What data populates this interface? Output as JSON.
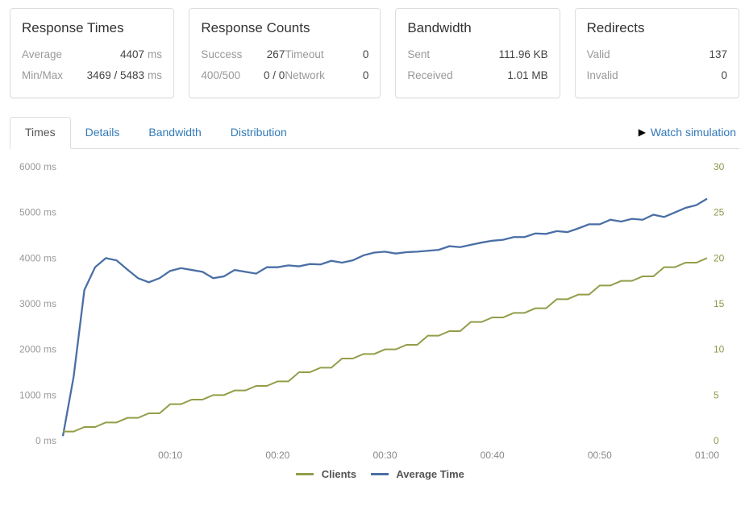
{
  "cards": {
    "response_times": {
      "title": "Response Times",
      "average_label": "Average",
      "average_value": "4407",
      "unit": "ms",
      "minmax_label": "Min/Max",
      "minmax_value": "3469 / 5483"
    },
    "response_counts": {
      "title": "Response Counts",
      "success_label": "Success",
      "success_value": "267",
      "timeout_label": "Timeout",
      "timeout_value": "0",
      "errcode_label": "400/500",
      "errcode_value": "0 / 0",
      "network_label": "Network",
      "network_value": "0"
    },
    "bandwidth": {
      "title": "Bandwidth",
      "sent_label": "Sent",
      "sent_value": "111.96 KB",
      "recv_label": "Received",
      "recv_value": "1.01 MB"
    },
    "redirects": {
      "title": "Redirects",
      "valid_label": "Valid",
      "valid_value": "137",
      "invalid_label": "Invalid",
      "invalid_value": "0"
    }
  },
  "tabs": {
    "times": "Times",
    "details": "Details",
    "bandwidth": "Bandwidth",
    "distribution": "Distribution"
  },
  "watch_simulation_label": "Watch simulation",
  "legend": {
    "clients": "Clients",
    "avg_time": "Average Time"
  },
  "chart_data": {
    "type": "line",
    "xlabel": "",
    "x_ticks": [
      "00:10",
      "00:20",
      "00:30",
      "00:40",
      "00:50",
      "01:00"
    ],
    "y_left": {
      "label": "",
      "unit": "ms",
      "ticks": [
        0,
        1000,
        2000,
        3000,
        4000,
        5000,
        6000
      ],
      "ylim": [
        0,
        6000
      ]
    },
    "y_right": {
      "label": "",
      "unit": "",
      "ticks": [
        0,
        5,
        10,
        15,
        20,
        25,
        30
      ],
      "ylim": [
        0,
        30
      ]
    },
    "series": [
      {
        "name": "Average Time",
        "axis": "left",
        "color": "#4a6fa5",
        "x": [
          0,
          1,
          2,
          3,
          4,
          5,
          6,
          7,
          8,
          9,
          10,
          11,
          12,
          13,
          14,
          15,
          16,
          17,
          18,
          19,
          20,
          21,
          22,
          23,
          24,
          25,
          26,
          27,
          28,
          29,
          30,
          31,
          32,
          33,
          34,
          35,
          36,
          37,
          38,
          39,
          40,
          41,
          42,
          43,
          44,
          45,
          46,
          47,
          48,
          49,
          50,
          51,
          52,
          53,
          54,
          55,
          56,
          57,
          58,
          59,
          60
        ],
        "values": [
          100,
          1400,
          3300,
          3800,
          4000,
          3950,
          3750,
          3560,
          3470,
          3560,
          3720,
          3780,
          3740,
          3700,
          3560,
          3600,
          3740,
          3700,
          3660,
          3800,
          3800,
          3840,
          3820,
          3870,
          3860,
          3940,
          3900,
          3950,
          4060,
          4120,
          4140,
          4100,
          4130,
          4140,
          4160,
          4180,
          4260,
          4240,
          4290,
          4340,
          4380,
          4400,
          4460,
          4460,
          4540,
          4530,
          4590,
          4570,
          4650,
          4740,
          4740,
          4840,
          4800,
          4860,
          4840,
          4950,
          4900,
          5000,
          5100,
          5160,
          5300
        ]
      },
      {
        "name": "Clients",
        "axis": "right",
        "color": "#949d49",
        "x": [
          0,
          1,
          2,
          3,
          4,
          5,
          6,
          7,
          8,
          9,
          10,
          11,
          12,
          13,
          14,
          15,
          16,
          17,
          18,
          19,
          20,
          21,
          22,
          23,
          24,
          25,
          26,
          27,
          28,
          29,
          30,
          31,
          32,
          33,
          34,
          35,
          36,
          37,
          38,
          39,
          40,
          41,
          42,
          43,
          44,
          45,
          46,
          47,
          48,
          49,
          50,
          51,
          52,
          53,
          54,
          55,
          56,
          57,
          58,
          59,
          60
        ],
        "values": [
          1,
          1,
          1.5,
          1.5,
          2,
          2,
          2.5,
          2.5,
          3,
          3,
          4,
          4,
          4.5,
          4.5,
          5,
          5,
          5.5,
          5.5,
          6,
          6,
          6.5,
          6.5,
          7.5,
          7.5,
          8,
          8,
          9,
          9,
          9.5,
          9.5,
          10,
          10,
          10.5,
          10.5,
          11.5,
          11.5,
          12,
          12,
          13,
          13,
          13.5,
          13.5,
          14,
          14,
          14.5,
          14.5,
          15.5,
          15.5,
          16,
          16,
          17,
          17,
          17.5,
          17.5,
          18,
          18,
          19,
          19,
          19.5,
          19.5,
          20
        ]
      }
    ]
  }
}
